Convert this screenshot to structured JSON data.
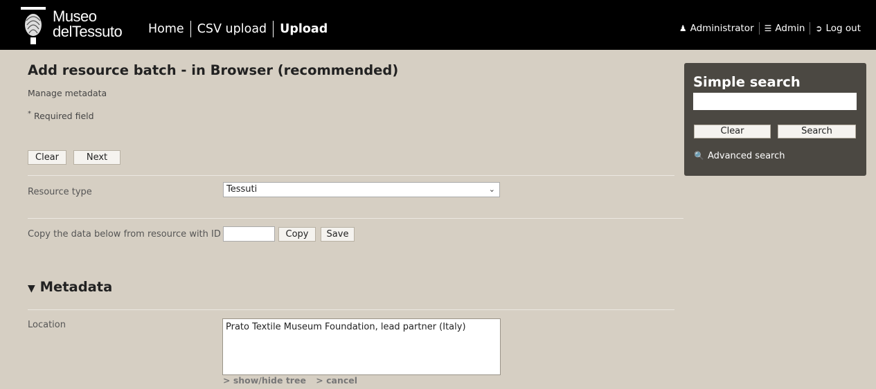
{
  "header": {
    "logo": {
      "line1": "Museo",
      "line2_a": "del",
      "line2_b": "Tessuto"
    },
    "nav": [
      {
        "label": "Home"
      },
      {
        "label": "CSV upload"
      },
      {
        "label": "Upload"
      }
    ],
    "user": {
      "label": "Administrator",
      "icon": "user-icon"
    },
    "admin": {
      "label": "Admin",
      "icon": "menu-icon"
    },
    "logout": {
      "label": "Log out",
      "icon": "logout-icon"
    }
  },
  "main": {
    "title": "Add resource batch - in Browser (recommended)",
    "subtitle": "Manage metadata",
    "required_marker": "*",
    "required_text": "Required field",
    "clear_label": "Clear",
    "next_label": "Next",
    "resource_type": {
      "label": "Resource type",
      "value": "Tessuti"
    },
    "copy_from": {
      "label": "Copy the data below from resource with ID",
      "value": "",
      "copy_label": "Copy",
      "save_label": "Save"
    },
    "metadata_heading": "Metadata",
    "location": {
      "label": "Location",
      "value": "Prato Textile Museum Foundation, lead partner (Italy)"
    },
    "tree_links": {
      "show_hide": "> show/hide tree",
      "cancel": "> cancel"
    }
  },
  "search": {
    "title": "Simple search",
    "value": "",
    "clear_label": "Clear",
    "search_label": "Search",
    "advanced_label": "Advanced search"
  }
}
